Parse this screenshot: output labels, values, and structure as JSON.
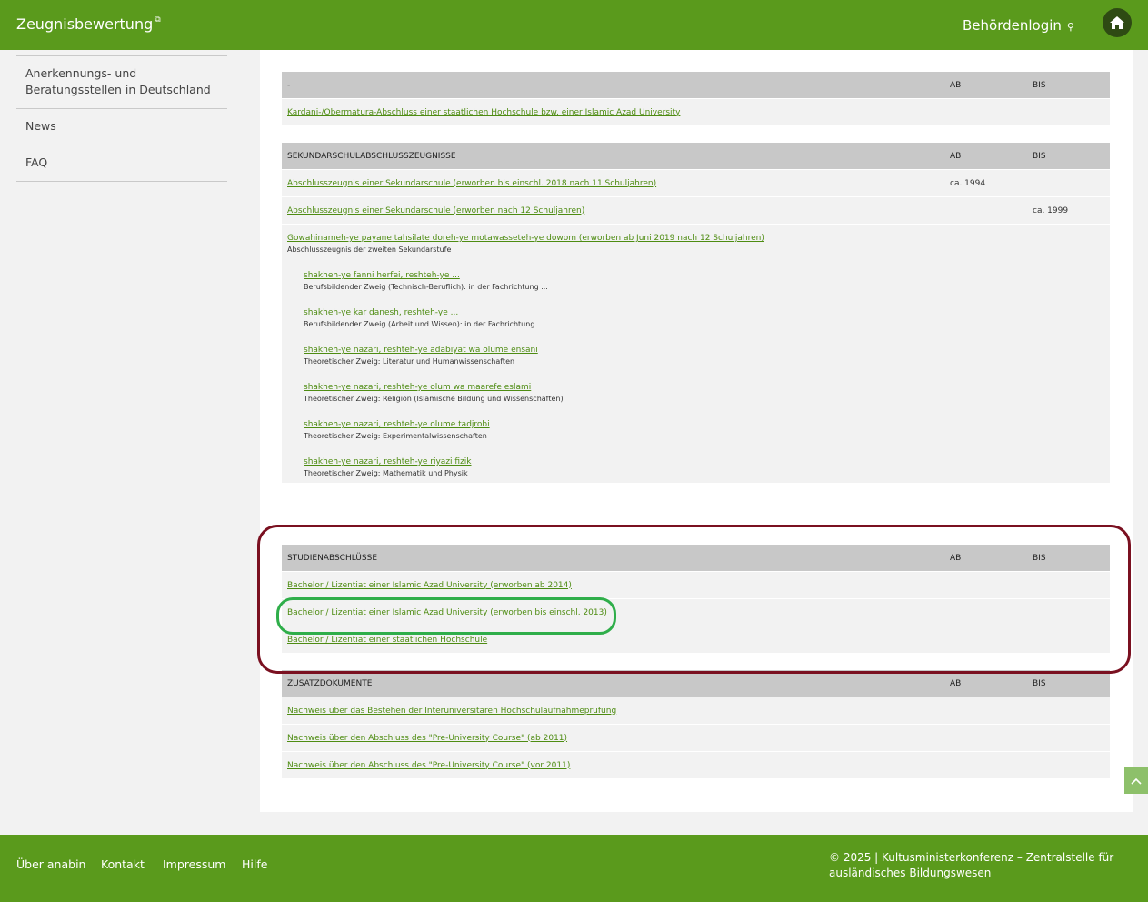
{
  "header": {
    "brand": "Zeugnisbewertung",
    "login": "Behördenlogin"
  },
  "sidebar": {
    "items": [
      {
        "label": "Anerkennungs- und Beratungsstellen in Deutschland"
      },
      {
        "label": "News"
      },
      {
        "label": "FAQ"
      }
    ]
  },
  "tables": {
    "t1": {
      "header": {
        "c1": "-",
        "ab": "AB",
        "bis": "BIS"
      },
      "rows": [
        {
          "label": "Kardani-/Obermatura-Abschluss einer staatlichen Hochschule bzw. einer Islamic Azad University"
        }
      ]
    },
    "t2": {
      "header": {
        "c1": "SEKUNDARSCHULABSCHLUSSZEUGNISSE",
        "ab": "AB",
        "bis": "BIS"
      },
      "rows": [
        {
          "label": "Abschlusszeugnis einer Sekundarschule (erworben bis einschl. 2018 nach 11 Schuljahren)",
          "ab": "ca. 1994"
        },
        {
          "label": "Abschlusszeugnis einer Sekundarschule (erworben nach 12 Schuljahren)",
          "bis": "ca. 1999"
        }
      ],
      "block": {
        "label": "Gowahinameh-ye payane tahsilate doreh-ye motawasseteh-ye dowom (erworben ab Juni 2019 nach 12 Schuljahren)",
        "desc": "Abschlusszeugnis der zweiten Sekundarstufe",
        "subs": [
          {
            "label": "shakheh-ye fanni herfei, reshteh-ye ...",
            "desc": "Berufsbildender Zweig (Technisch-Beruflich): in der Fachrichtung ..."
          },
          {
            "label": "shakheh-ye kar danesh, reshteh-ye ...",
            "desc": "Berufsbildender Zweig (Arbeit und Wissen): in der Fachrichtung..."
          },
          {
            "label": "shakheh-ye nazari, reshteh-ye adabiyat wa olume ensani",
            "desc": "Theoretischer Zweig: Literatur und Humanwissenschaften"
          },
          {
            "label": "shakheh-ye nazari, reshteh-ye olum wa maarefe eslami",
            "desc": "Theoretischer Zweig: Religion (Islamische Bildung und Wissenschaften)"
          },
          {
            "label": "shakheh-ye nazari, reshteh-ye olume tadjrobi",
            "desc": "Theoretischer Zweig: Experimentalwissenschaften"
          },
          {
            "label": "shakheh-ye nazari, reshteh-ye riyazi fizik",
            "desc": "Theoretischer Zweig: Mathematik und Physik"
          }
        ]
      }
    },
    "t3": {
      "header": {
        "c1": "STUDIENABSCHLÜSSE",
        "ab": "AB",
        "bis": "BIS"
      },
      "rows": [
        {
          "label": "Bachelor / Lizentiat einer Islamic Azad University (erworben ab 2014)"
        },
        {
          "label": "Bachelor / Lizentiat einer Islamic Azad University (erworben bis einschl. 2013)"
        },
        {
          "label": "Bachelor / Lizentiat einer staatlichen Hochschule"
        }
      ]
    },
    "t4": {
      "header": {
        "c1": "ZUSATZDOKUMENTE",
        "ab": "AB",
        "bis": "BIS"
      },
      "rows": [
        {
          "label": "Nachweis über das Bestehen der Interuniversitären Hochschulaufnahmeprüfung"
        },
        {
          "label": "Nachweis über den Abschluss des \"Pre-University Course\" (ab 2011)"
        },
        {
          "label": "Nachweis über den Abschluss des \"Pre-University Course\" (vor 2011)"
        }
      ]
    }
  },
  "footer": {
    "links": [
      "Über anabin",
      "Kontakt",
      "Impressum",
      "Hilfe"
    ],
    "copyright": "© 2025 | Kultusministerkonferenz – Zentralstelle für ausländisches Bildungswesen"
  }
}
